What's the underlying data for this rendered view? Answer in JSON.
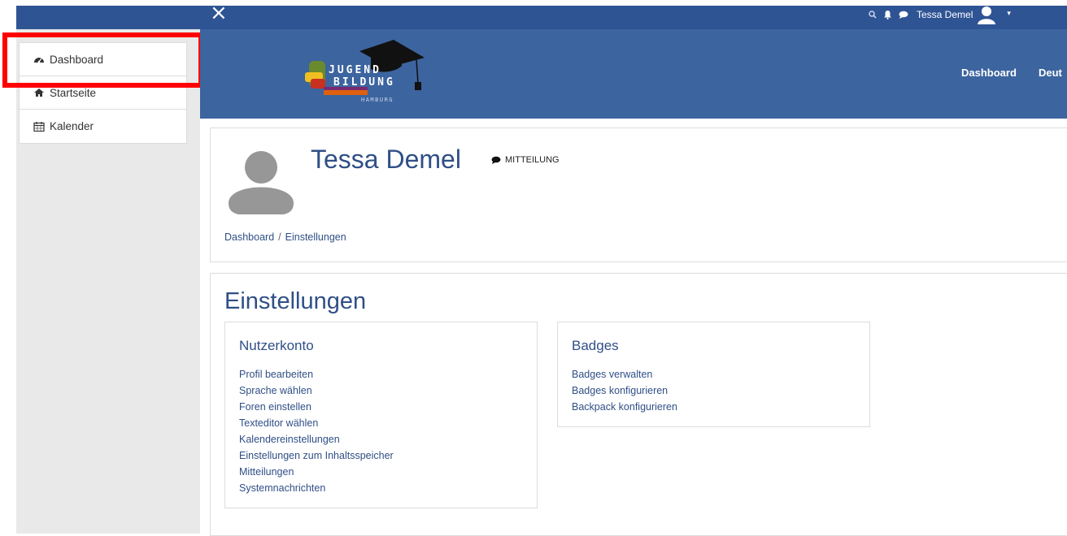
{
  "topbar": {
    "close_label": "×",
    "icons": [
      "search-icon",
      "bell-icon",
      "chat-icon"
    ],
    "user_name": "Tessa Demel",
    "caret": "▾"
  },
  "sidebar": {
    "items": [
      {
        "label": "Dashboard",
        "icon": "dashboard-icon"
      },
      {
        "label": "Startseite",
        "icon": "home-icon"
      },
      {
        "label": "Kalender",
        "icon": "calendar-icon"
      }
    ]
  },
  "header": {
    "logo": {
      "line1": "JUGEND",
      "line2": "BILDUNG",
      "line3": "HAMBURG"
    },
    "nav": [
      "Dashboard",
      "Deut"
    ]
  },
  "profile": {
    "name": "Tessa Demel",
    "message_label": "MITTEILUNG",
    "breadcrumb": [
      "Dashboard",
      "Einstellungen"
    ]
  },
  "settings": {
    "title": "Einstellungen",
    "account": {
      "title": "Nutzerkonto",
      "links": [
        "Profil bearbeiten",
        "Sprache wählen",
        "Foren einstellen",
        "Texteditor wählen",
        "Kalendereinstellungen",
        "Einstellungen zum Inhaltsspeicher",
        "Mitteilungen",
        "Systemnachrichten"
      ]
    },
    "badges": {
      "title": "Badges",
      "links": [
        "Badges verwalten",
        "Badges konfigurieren",
        "Backpack konfigurieren"
      ]
    }
  },
  "colors": {
    "navbar": "#2f5494",
    "header": "#3c649f",
    "link": "#2f4f86",
    "highlight": "#ff0000"
  }
}
